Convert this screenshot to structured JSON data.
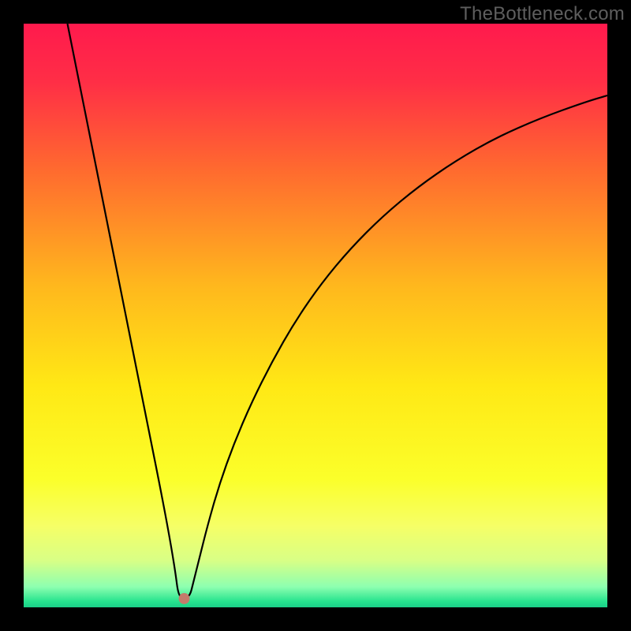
{
  "watermark": "TheBottleneck.com",
  "chart_data": {
    "type": "line",
    "title": "",
    "xlabel": "",
    "ylabel": "",
    "xlim": [
      0,
      1
    ],
    "ylim": [
      0,
      1
    ],
    "gradient_stops": [
      {
        "offset": 0.0,
        "color": "#ff1a4d"
      },
      {
        "offset": 0.1,
        "color": "#ff2e46"
      },
      {
        "offset": 0.25,
        "color": "#ff6a2f"
      },
      {
        "offset": 0.45,
        "color": "#ffb81d"
      },
      {
        "offset": 0.62,
        "color": "#ffe815"
      },
      {
        "offset": 0.78,
        "color": "#fbff2a"
      },
      {
        "offset": 0.86,
        "color": "#f6ff66"
      },
      {
        "offset": 0.92,
        "color": "#d8ff86"
      },
      {
        "offset": 0.965,
        "color": "#8dffb0"
      },
      {
        "offset": 0.99,
        "color": "#26e38e"
      },
      {
        "offset": 1.0,
        "color": "#1bcf88"
      }
    ],
    "min_marker": {
      "x": 0.275,
      "y": 0.985,
      "color": "#c47b6b",
      "r": 7
    },
    "series": [
      {
        "name": "bottleneck-curve",
        "color": "#000000",
        "width": 2.2,
        "points": [
          {
            "x": 0.075,
            "y": 0.0
          },
          {
            "x": 0.095,
            "y": 0.1
          },
          {
            "x": 0.115,
            "y": 0.2
          },
          {
            "x": 0.135,
            "y": 0.3
          },
          {
            "x": 0.155,
            "y": 0.4
          },
          {
            "x": 0.175,
            "y": 0.5
          },
          {
            "x": 0.195,
            "y": 0.6
          },
          {
            "x": 0.215,
            "y": 0.7
          },
          {
            "x": 0.235,
            "y": 0.8
          },
          {
            "x": 0.25,
            "y": 0.88
          },
          {
            "x": 0.26,
            "y": 0.94
          },
          {
            "x": 0.265,
            "y": 0.98
          },
          {
            "x": 0.275,
            "y": 0.985
          },
          {
            "x": 0.285,
            "y": 0.98
          },
          {
            "x": 0.29,
            "y": 0.96
          },
          {
            "x": 0.3,
            "y": 0.92
          },
          {
            "x": 0.315,
            "y": 0.86
          },
          {
            "x": 0.335,
            "y": 0.79
          },
          {
            "x": 0.36,
            "y": 0.72
          },
          {
            "x": 0.39,
            "y": 0.65
          },
          {
            "x": 0.425,
            "y": 0.58
          },
          {
            "x": 0.465,
            "y": 0.51
          },
          {
            "x": 0.51,
            "y": 0.445
          },
          {
            "x": 0.56,
            "y": 0.385
          },
          {
            "x": 0.615,
            "y": 0.33
          },
          {
            "x": 0.675,
            "y": 0.28
          },
          {
            "x": 0.74,
            "y": 0.235
          },
          {
            "x": 0.81,
            "y": 0.195
          },
          {
            "x": 0.885,
            "y": 0.162
          },
          {
            "x": 0.96,
            "y": 0.135
          },
          {
            "x": 1.0,
            "y": 0.123
          }
        ]
      }
    ]
  }
}
